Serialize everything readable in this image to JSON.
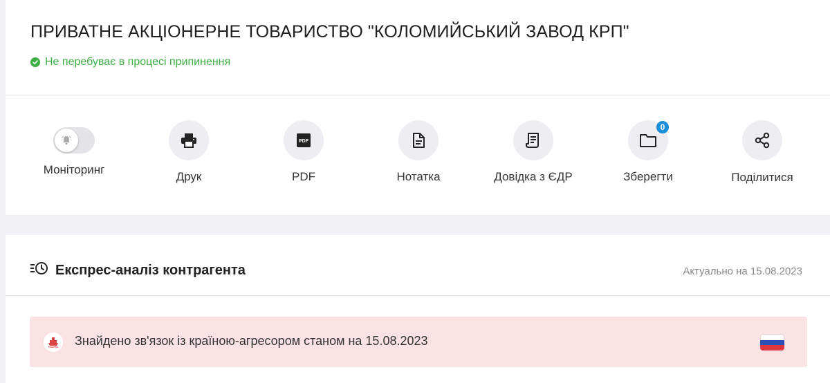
{
  "company": {
    "title": "ПРИВАТНЕ АКЦІОНЕРНЕ ТОВАРИСТВО \"КОЛОМИЙСЬКИЙ ЗАВОД КРП\"",
    "status": "Не перебуває в процесі припинення",
    "status_icon": "check-circle-icon",
    "status_color": "#3cb043"
  },
  "actions": [
    {
      "label": "Моніторинг",
      "icon": "bell-toggle-icon"
    },
    {
      "label": "Друк",
      "icon": "printer-icon"
    },
    {
      "label": "PDF",
      "icon": "pdf-icon"
    },
    {
      "label": "Нотатка",
      "icon": "note-icon"
    },
    {
      "label": "Довідка з ЄДР",
      "icon": "document-icon"
    },
    {
      "label": "Зберегти",
      "icon": "folder-icon",
      "badge": "0"
    },
    {
      "label": "Поділитися",
      "icon": "share-icon"
    }
  ],
  "express": {
    "title": "Експрес-аналіз контрагента",
    "icon": "history-icon",
    "date": "Актуально на 15.08.2023"
  },
  "alert": {
    "text": "Знайдено зв'язок із країною-агресором станом на 15.08.2023",
    "icon": "ship-icon",
    "flag_icon": "russia-flag-icon",
    "bg_color": "#fbe3e5"
  },
  "colors": {
    "accent_badge": "#1a8fd8",
    "text": "#222222"
  }
}
